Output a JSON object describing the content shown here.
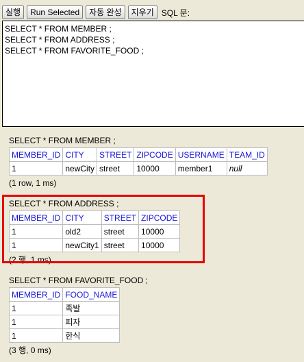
{
  "toolbar": {
    "run_label": "실행",
    "run_selected_label": "Run Selected",
    "autocomplete_label": "자동 완성",
    "clear_label": "지우기",
    "sql_label": "SQL 문:"
  },
  "editor": {
    "text": "SELECT * FROM MEMBER ;\nSELECT * FROM ADDRESS ;\nSELECT * FROM FAVORITE_FOOD ;"
  },
  "results": [
    {
      "query": "SELECT * FROM MEMBER ;",
      "columns": [
        "MEMBER_ID",
        "CITY",
        "STREET",
        "ZIPCODE",
        "USERNAME",
        "TEAM_ID"
      ],
      "rows": [
        [
          "1",
          "newCity",
          "street",
          "10000",
          "member1",
          "null"
        ]
      ],
      "meta": "(1 row, 1 ms)"
    },
    {
      "query": "SELECT * FROM ADDRESS ;",
      "columns": [
        "MEMBER_ID",
        "CITY",
        "STREET",
        "ZIPCODE"
      ],
      "rows": [
        [
          "1",
          "old2",
          "street",
          "10000"
        ],
        [
          "1",
          "newCity1",
          "street",
          "10000"
        ]
      ],
      "meta": "(2 행, 1 ms)"
    },
    {
      "query": "SELECT * FROM FAVORITE_FOOD ;",
      "columns": [
        "MEMBER_ID",
        "FOOD_NAME"
      ],
      "rows": [
        [
          "1",
          "족발"
        ],
        [
          "1",
          "피자"
        ],
        [
          "1",
          "한식"
        ]
      ],
      "meta": "(3 행, 0 ms)"
    }
  ],
  "colors": {
    "header_text": "#1a1ad6",
    "highlight_border": "#e60000",
    "background": "#ece9d8"
  }
}
